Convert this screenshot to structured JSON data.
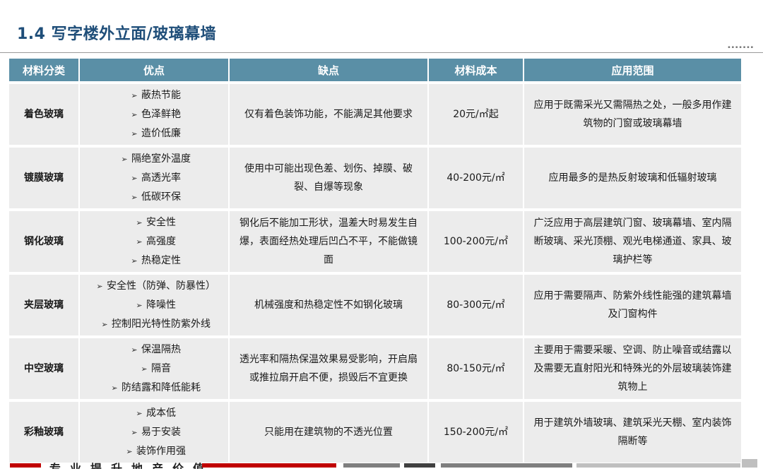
{
  "header": {
    "title": "1.4 写字楼外立面/玻璃幕墙"
  },
  "table": {
    "headers": [
      "材料分类",
      "优点",
      "缺点",
      "材料成本",
      "应用范围"
    ],
    "rows": [
      {
        "name": "着色玻璃",
        "pros": [
          "蔽热节能",
          "色泽鲜艳",
          "造价低廉"
        ],
        "cons": "仅有着色装饰功能，不能满足其他要求",
        "cost": "20元/㎡起",
        "scope": "应用于既需采光又需隔热之处，一般多用作建筑物的门窗或玻璃幕墙"
      },
      {
        "name": "镀膜玻璃",
        "pros": [
          "隔绝室外温度",
          "高透光率",
          "低碳环保"
        ],
        "cons": "使用中可能出现色差、划伤、掉膜、破裂、自爆等现象",
        "cost": "40-200元/㎡",
        "scope": "应用最多的是热反射玻璃和低辐射玻璃"
      },
      {
        "name": "钢化玻璃",
        "pros": [
          "安全性",
          "高强度",
          "热稳定性"
        ],
        "cons": "钢化后不能加工形状，温差大时易发生自爆，表面经热处理后凹凸不平，不能做镜面",
        "cost": "100-200元/㎡",
        "scope": "广泛应用于高层建筑门窗、玻璃幕墙、室内隔断玻璃、采光顶棚、观光电梯通道、家具、玻璃护栏等"
      },
      {
        "name": "夹层玻璃",
        "pros": [
          "安全性（防弹、防暴性）",
          "降噪性",
          "控制阳光特性防紫外线"
        ],
        "cons": "机械强度和热稳定性不如钢化玻璃",
        "cost": "80-300元/㎡",
        "scope": "应用于需要隔声、防紫外线性能强的建筑幕墙及门窗构件"
      },
      {
        "name": "中空玻璃",
        "pros": [
          "保温隔热",
          "隔音",
          "防结露和降低能耗"
        ],
        "cons": "透光率和隔热保温效果易受影响，开启扇或推拉扇开启不便，损毁后不宜更换",
        "cost": "80-150元/㎡",
        "scope": "主要用于需要采暖、空调、防止噪音或结露以及需要无直射阳光和特殊光的外层玻璃装饰建筑物上"
      },
      {
        "name": "彩釉玻璃",
        "pros": [
          "成本低",
          "易于安装",
          "装饰作用强"
        ],
        "cons": "只能用在建筑物的不透光位置",
        "cost": "150-200元/㎡",
        "scope": "用于建筑外墙玻璃、建筑采光天棚、室内装饰隔断等"
      }
    ]
  },
  "footer": {
    "slogan": "专业提升地产价值"
  },
  "colors": {
    "title": "#1f4e79",
    "header_bg": "#5a8fa6",
    "cell_bg": "#ececec",
    "footer_red": "#c00000"
  }
}
